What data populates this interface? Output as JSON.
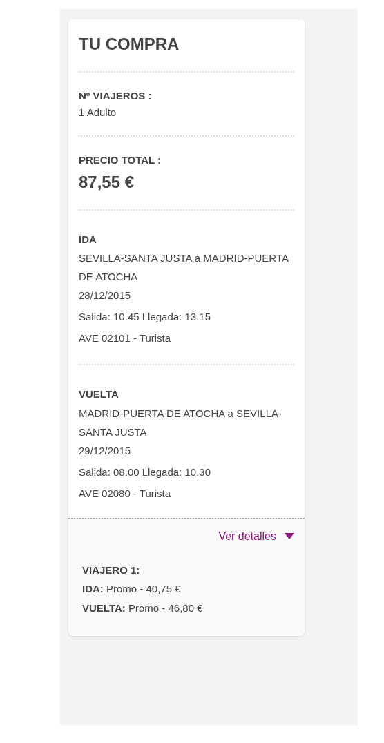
{
  "title": "TU COMPRA",
  "travellers": {
    "label": "Nº VIAJEROS :",
    "value": "1 Adulto"
  },
  "total": {
    "label": "PRECIO TOTAL :",
    "value": "87,55 €"
  },
  "legs": [
    {
      "label": "IDA",
      "route": "SEVILLA-SANTA JUSTA a MADRID-PUERTA DE ATOCHA",
      "date": "28/12/2015",
      "times": "Salida: 10.45 Llegada: 13.15",
      "train": "AVE 02101 - Turista"
    },
    {
      "label": "VUELTA",
      "route": "MADRID-PUERTA DE ATOCHA a SEVILLA-SANTA JUSTA",
      "date": "29/12/2015",
      "times": "Salida: 08.00 Llegada: 10.30",
      "train": "AVE 02080 - Turista"
    }
  ],
  "details": {
    "link": "Ver detalles",
    "expanded": true,
    "passenger": "VIAJERO 1:",
    "fares": [
      "**IDA:** Promo - 40,75 €",
      "**VUELTA:** Promo - 46,80 €"
    ]
  }
}
